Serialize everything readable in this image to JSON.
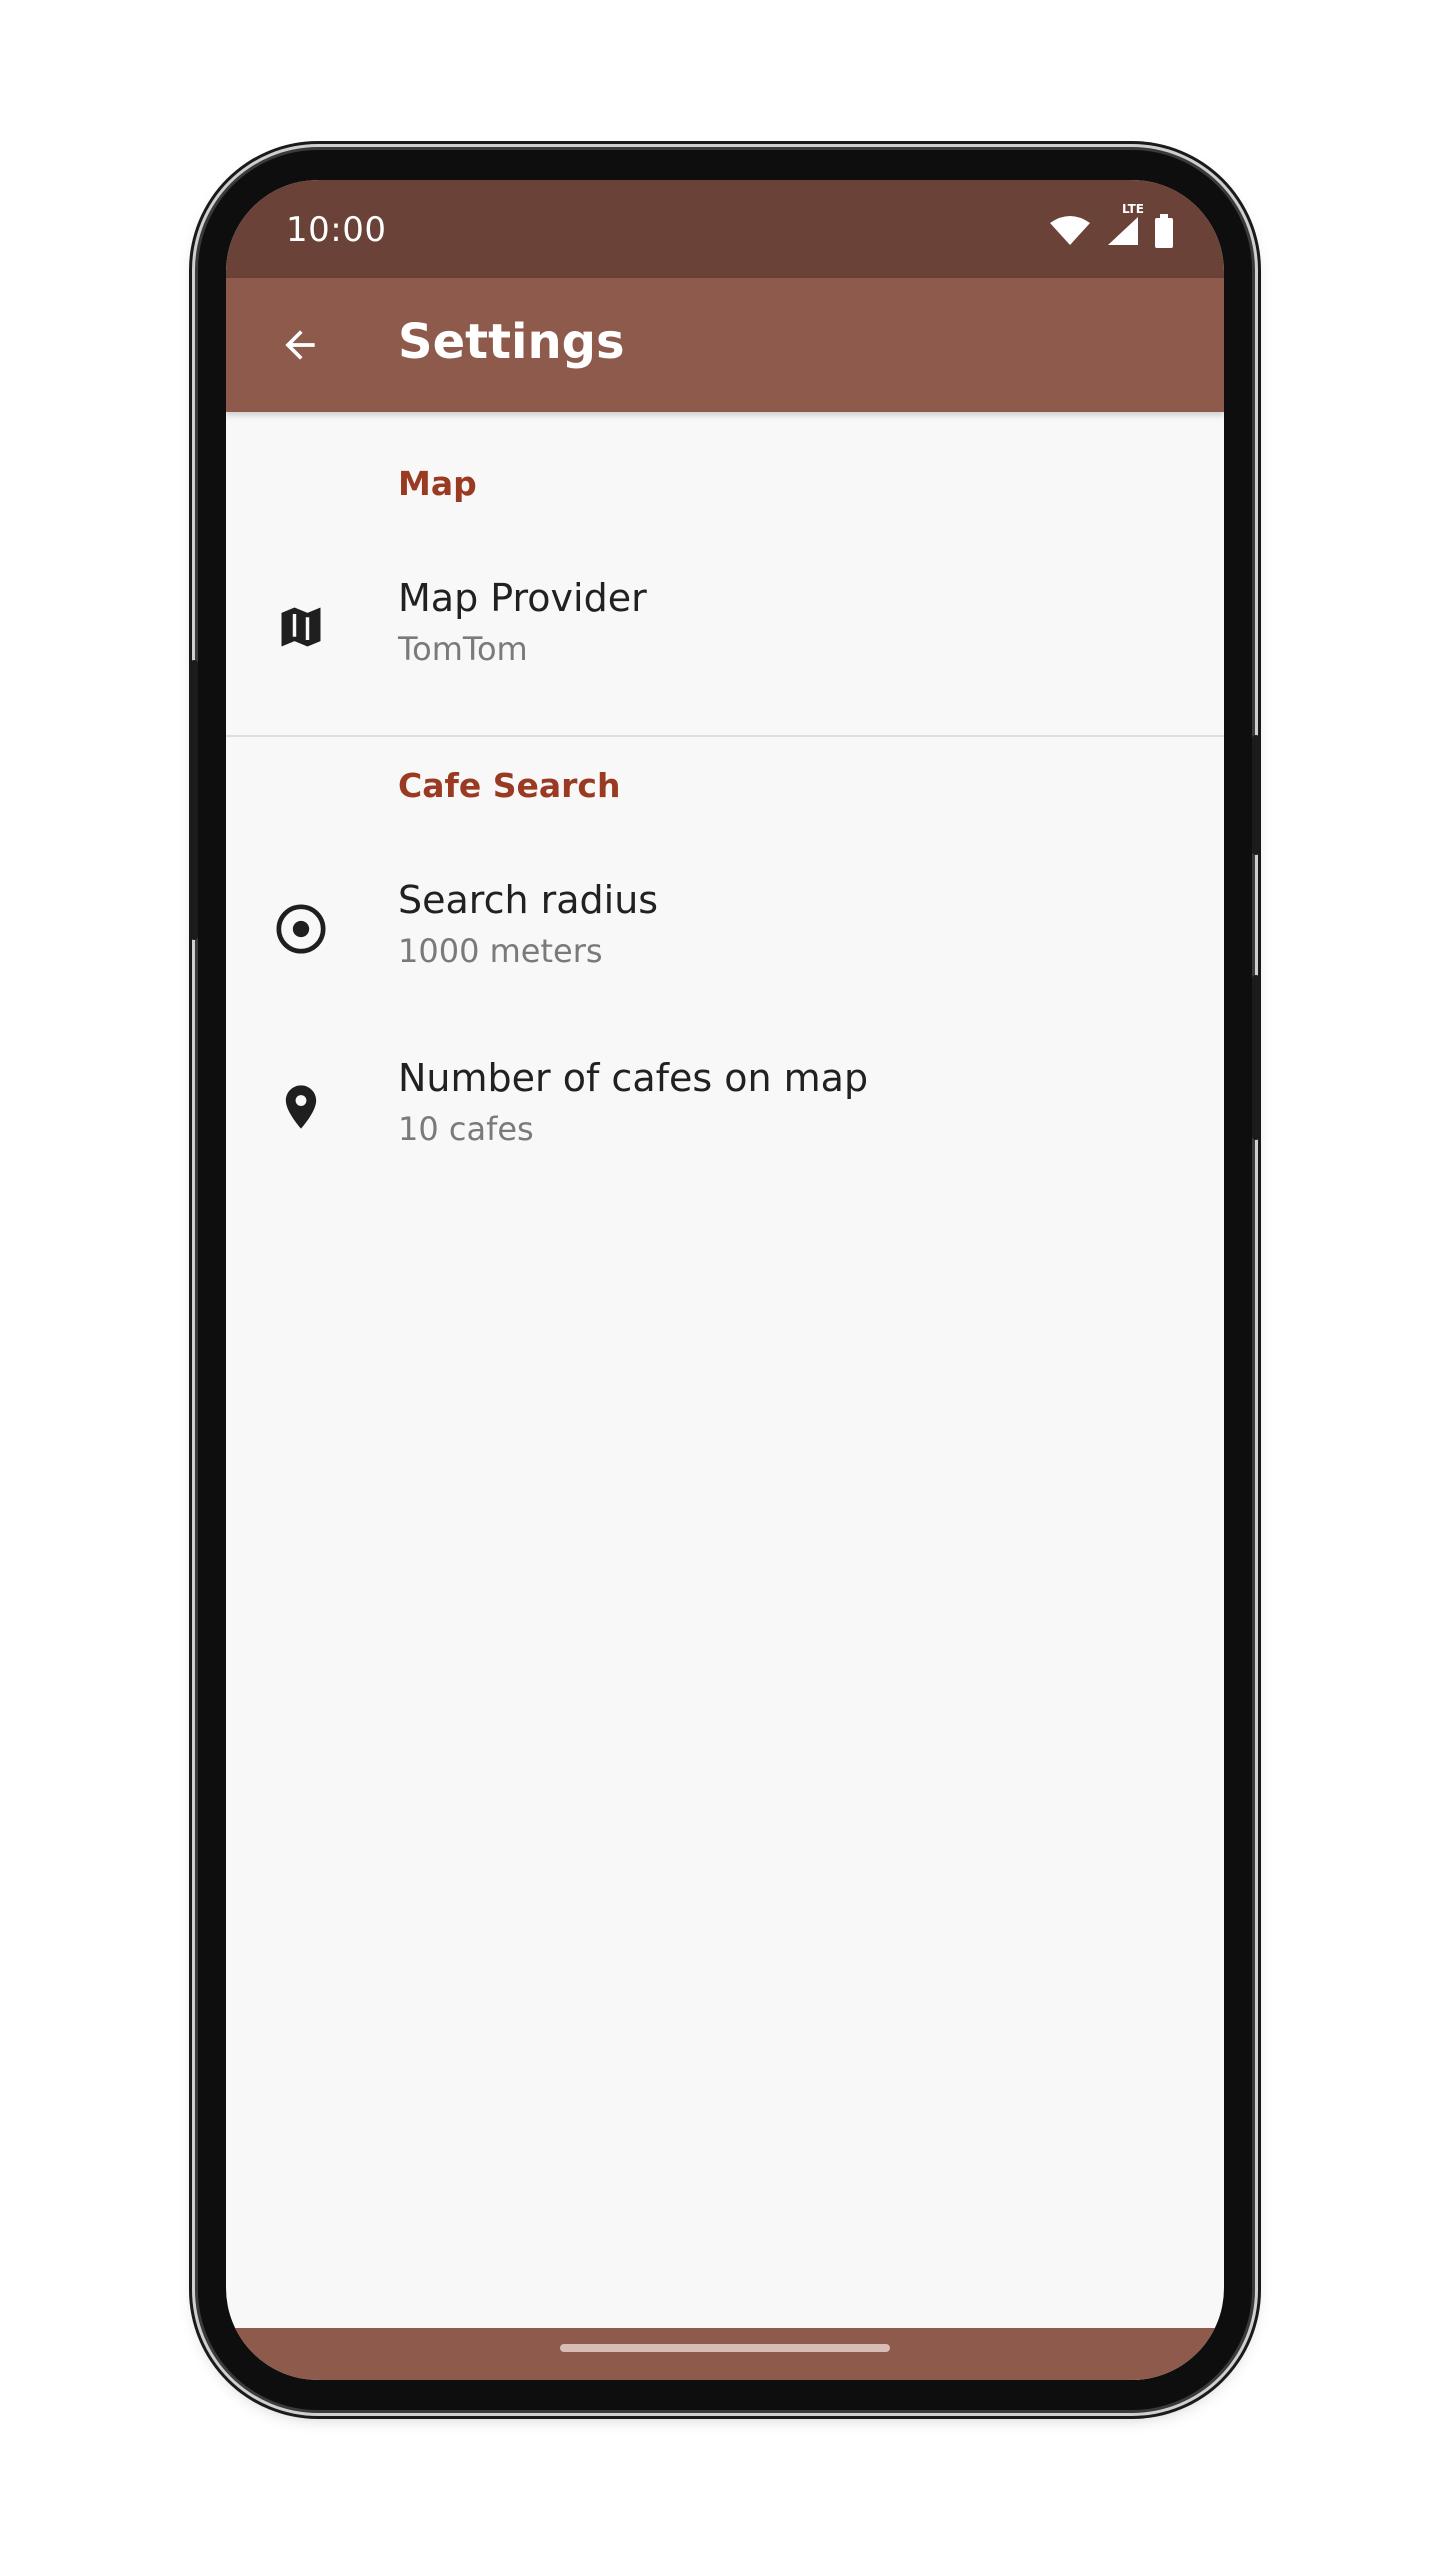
{
  "status_bar": {
    "time": "10:00",
    "network_label": "LTE",
    "icons": [
      "wifi-icon",
      "signal-icon",
      "battery-icon"
    ]
  },
  "app_bar": {
    "title": "Settings",
    "back_icon": "arrow-back-icon"
  },
  "sections": [
    {
      "title": "Map",
      "items": [
        {
          "title": "Map Provider",
          "summary": "TomTom",
          "icon": "map-icon"
        }
      ]
    },
    {
      "title": "Cafe Search",
      "items": [
        {
          "title": "Search radius",
          "summary": "1000 meters",
          "icon": "radius-target-icon"
        },
        {
          "title": "Number of cafes on map",
          "summary": "10 cafes",
          "icon": "location-pin-icon"
        }
      ]
    }
  ],
  "colors": {
    "status_bar": "#6b4237",
    "app_bar": "#8d5a4c",
    "accent": "#9a3a22",
    "background": "#f8f8f8"
  }
}
